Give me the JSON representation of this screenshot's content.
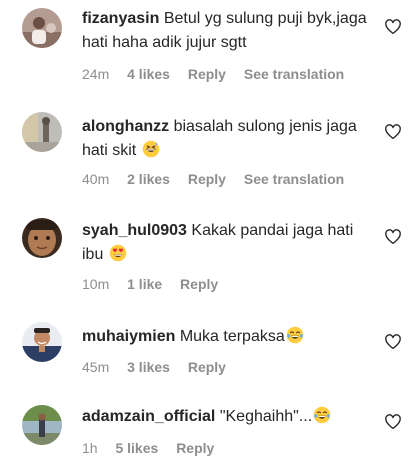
{
  "comments": [
    {
      "username": "fizanyasin",
      "text": "Betul yg sulung puji byk,jaga hati haha adik jujur sgtt",
      "emoji": "",
      "time": "24m",
      "likes": "4 likes",
      "reply": "Reply",
      "translate": "See translation"
    },
    {
      "username": "alonghanzz",
      "text": "biasalah sulong jenis jaga hati skit",
      "emoji": "grinning-sweat-emoji",
      "time": "40m",
      "likes": "2 likes",
      "reply": "Reply",
      "translate": "See translation"
    },
    {
      "username": "syah_hul0903",
      "text": "Kakak pandai jaga hati ibu",
      "emoji": "heart-eyes-emoji",
      "time": "10m",
      "likes": "1 like",
      "reply": "Reply",
      "translate": ""
    },
    {
      "username": "muhaiymien",
      "text": "Muka terpaksa",
      "emoji": "tears-of-joy-emoji",
      "time": "45m",
      "likes": "3 likes",
      "reply": "Reply",
      "translate": ""
    },
    {
      "username": "adamzain_official",
      "text": "\"Keghaihh\"...",
      "emoji": "tears-of-joy-emoji",
      "time": "1h",
      "likes": "5 likes",
      "reply": "Reply",
      "translate": ""
    }
  ],
  "colors": {
    "text": "#262626",
    "meta": "#8e8e8e",
    "background": "#ffffff"
  }
}
